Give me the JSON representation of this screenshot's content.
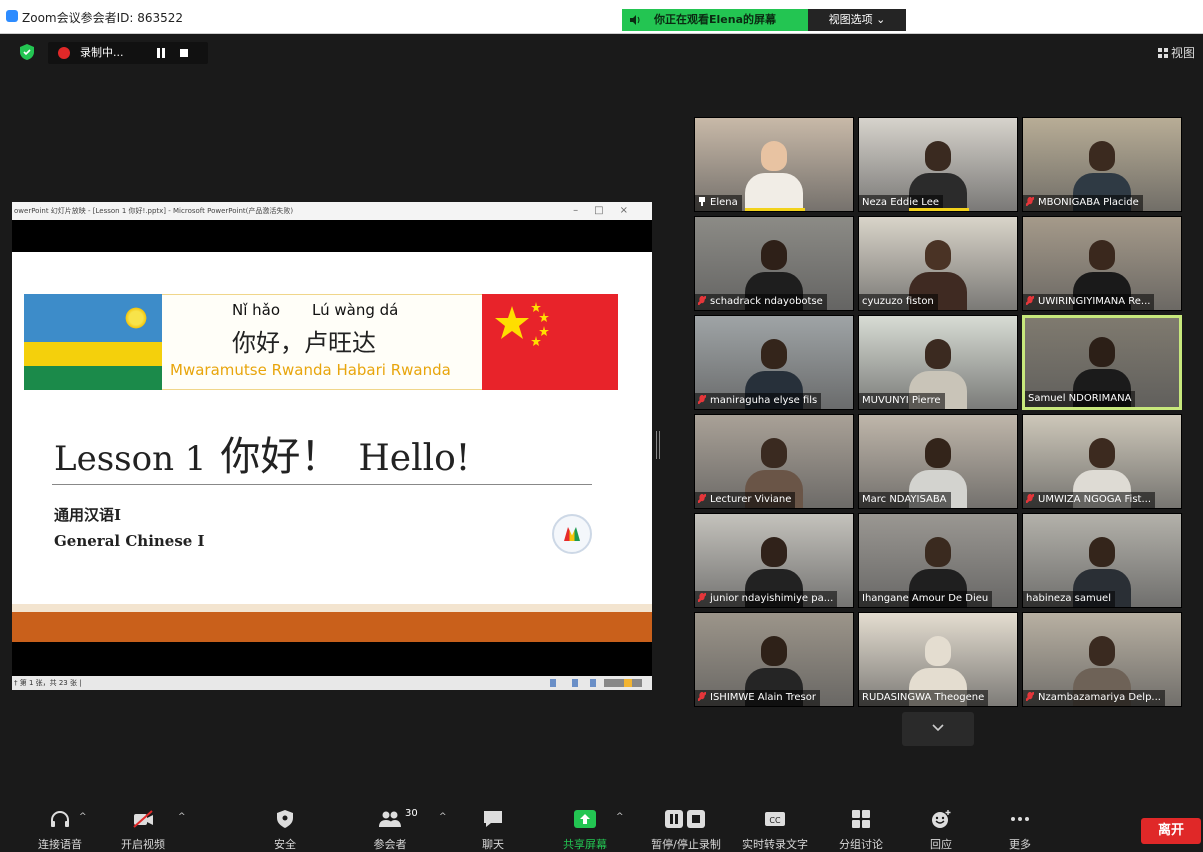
{
  "window": {
    "title": "Zoom会议参会者ID: 863522"
  },
  "share_banner": {
    "text": "你正在观看Elena的屏幕",
    "view_options": "视图选项 ⌄"
  },
  "recording": {
    "label": "录制中..."
  },
  "view_button": {
    "label": "视图"
  },
  "powerpoint": {
    "titlebar": "owerPoint 幻灯片放映 - [Lesson 1 你好!.pptx] - Microsoft PowerPoint(产品激活失败)",
    "window_controls": "–□×",
    "statusbar": "† 第 1 张，共 23 张 |"
  },
  "slide": {
    "pinyin_ni_hao": "Nǐ hǎo",
    "pinyin_lu_wang_da": "Lú wàng dá",
    "greeting_cn": "你好，卢旺达",
    "greeting_sw": "Mwaramutse Rwanda  Habari Rwanda",
    "lesson_label": "Lesson 1",
    "lesson_cn": "你好！",
    "lesson_en": "Hello!",
    "course_cn": "通用汉语I",
    "course_en": "General Chinese I"
  },
  "participants": [
    {
      "name": "Elena",
      "icon": "pin-icon",
      "speaking": true,
      "bg": "#c8b9a8",
      "skin": "#e8c3a2",
      "shirt": "#f1ede6"
    },
    {
      "name": "Neza Eddie Lee",
      "icon": "",
      "speaking": true,
      "bg": "#d7d3cc",
      "skin": "#3a2a20",
      "shirt": "#2b2b2b"
    },
    {
      "name": "MBONIGABA Placide",
      "icon": "mic-muted-icon",
      "speaking": false,
      "bg": "#b8ad96",
      "skin": "#3b2a1f",
      "shirt": "#2f3a44"
    },
    {
      "name": "schadrack ndayobotse",
      "icon": "mic-muted-icon",
      "speaking": false,
      "bg": "#8c8b86",
      "skin": "#2e2018",
      "shirt": "#1e1e1e"
    },
    {
      "name": "cyuzuzo fiston",
      "icon": "",
      "speaking": false,
      "bg": "#d9d4c9",
      "skin": "#4a3325",
      "shirt": "#3f2a22"
    },
    {
      "name": "UWIRINGIYIMANA Re...",
      "icon": "mic-muted-icon",
      "speaking": false,
      "bg": "#a59a8a",
      "skin": "#3a281d",
      "shirt": "#1a1a1a"
    },
    {
      "name": "maniraguha elyse fils",
      "icon": "mic-muted-icon",
      "speaking": false,
      "bg": "#9fa4a6",
      "skin": "#34251b",
      "shirt": "#27303a"
    },
    {
      "name": "MUVUNYI Pierre",
      "icon": "",
      "speaking": false,
      "bg": "#d8dcd4",
      "skin": "#3b2a20",
      "shirt": "#c9c4b8"
    },
    {
      "name": "Samuel NDORIMANA",
      "icon": "",
      "speaking": false,
      "bg": "#7f7a6f",
      "skin": "#2c1f17",
      "shirt": "#1b1b1b",
      "active": true
    },
    {
      "name": "Lecturer Viviane",
      "icon": "mic-muted-icon",
      "speaking": false,
      "bg": "#a9a197",
      "skin": "#3a2a20",
      "shirt": "#6a5547"
    },
    {
      "name": "Marc NDAYISABA",
      "icon": "",
      "speaking": false,
      "bg": "#bfb6aa",
      "skin": "#33241a",
      "shirt": "#d3d3cf"
    },
    {
      "name": "UMWIZA NGOGA Fist...",
      "icon": "mic-muted-icon",
      "speaking": false,
      "bg": "#cdc7b9",
      "skin": "#3c2a1f",
      "shirt": "#dedbd4"
    },
    {
      "name": "junior ndayishimiye pa...",
      "icon": "mic-muted-icon",
      "speaking": false,
      "bg": "#c4c2bc",
      "skin": "#30221a",
      "shirt": "#222222"
    },
    {
      "name": "Ihangane Amour De Dieu",
      "icon": "",
      "speaking": false,
      "bg": "#9a9792",
      "skin": "#3a2a1f",
      "shirt": "#1f1f1f"
    },
    {
      "name": "habineza samuel",
      "icon": "",
      "speaking": false,
      "bg": "#b3b1aa",
      "skin": "#34251b",
      "shirt": "#2a2f35"
    },
    {
      "name": "ISHIMWE Alain Tresor",
      "icon": "mic-muted-icon",
      "speaking": false,
      "bg": "#9c958a",
      "skin": "#2e2118",
      "shirt": "#252525"
    },
    {
      "name": "RUDASINGWA Theogene",
      "icon": "",
      "speaking": false,
      "bg": "#e4ddd0",
      "skin": "#e4ddd0",
      "shirt": "#e4ddd0"
    },
    {
      "name": "Nzambazamariya Delp...",
      "icon": "mic-muted-icon",
      "speaking": false,
      "bg": "#b8b0a2",
      "skin": "#3a2a20",
      "shirt": "#6e6257"
    }
  ],
  "toolbar": {
    "audio": "连接语音",
    "video": "开启视频",
    "security": "安全",
    "participants": "参会者",
    "participants_count": "30",
    "chat": "聊天",
    "share": "共享屏幕",
    "record": "暂停/停止录制",
    "captions": "实时转录文字",
    "breakout": "分组讨论",
    "reactions": "回应",
    "more": "更多",
    "leave": "离开"
  },
  "colors": {
    "accent_green": "#23c552",
    "leave_red": "#e02828",
    "speaking_yellow": "#f2d21b",
    "active_border": "#c7e87c"
  }
}
